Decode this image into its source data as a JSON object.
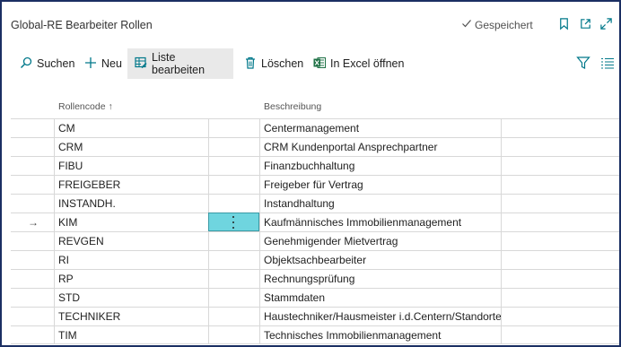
{
  "header": {
    "title": "Global-RE Bearbeiter Rollen",
    "saved_label": "Gespeichert"
  },
  "actions": {
    "search": "Suchen",
    "new": "Neu",
    "edit_list": "Liste bearbeiten",
    "delete": "Löschen",
    "excel": "In Excel öffnen"
  },
  "table": {
    "col_code": "Rollencode ↑",
    "col_desc": "Beschreibung",
    "rows": [
      {
        "code": "CM",
        "desc": "Centermanagement"
      },
      {
        "code": "CRM",
        "desc": "CRM Kundenportal Ansprechpartner"
      },
      {
        "code": "FIBU",
        "desc": "Finanzbuchhaltung"
      },
      {
        "code": "FREIGEBER",
        "desc": "Freigeber für Vertrag"
      },
      {
        "code": "INSTANDH.",
        "desc": "Instandhaltung"
      },
      {
        "code": "KIM",
        "desc": "Kaufmännisches Immobilienmanagement",
        "selected": true,
        "marker": "→"
      },
      {
        "code": "REVGEN",
        "desc": "Genehmigender Mietvertrag"
      },
      {
        "code": "RI",
        "desc": "Objektsachbearbeiter"
      },
      {
        "code": "RP",
        "desc": "Rechnungsprüfung"
      },
      {
        "code": "STD",
        "desc": "Stammdaten"
      },
      {
        "code": "TECHNIKER",
        "desc": "Haustechniker/Hausmeister i.d.Centern/Standorten"
      },
      {
        "code": "TIM",
        "desc": "Technisches Immobilienmanagement"
      }
    ]
  },
  "colors": {
    "frame": "#1b2f63",
    "accent": "#00788a",
    "selected_cell": "#6fd5df",
    "excel_green": "#1e7145"
  },
  "icons": {
    "saved": "check-icon",
    "bookmark": "bookmark-icon",
    "share": "open-external-icon",
    "expand": "expand-icon",
    "search": "search-icon",
    "new": "plus-icon",
    "edit_list": "edit-list-icon",
    "delete": "trash-icon",
    "excel": "excel-icon",
    "filter": "filter-icon",
    "list_view": "list-view-icon"
  }
}
